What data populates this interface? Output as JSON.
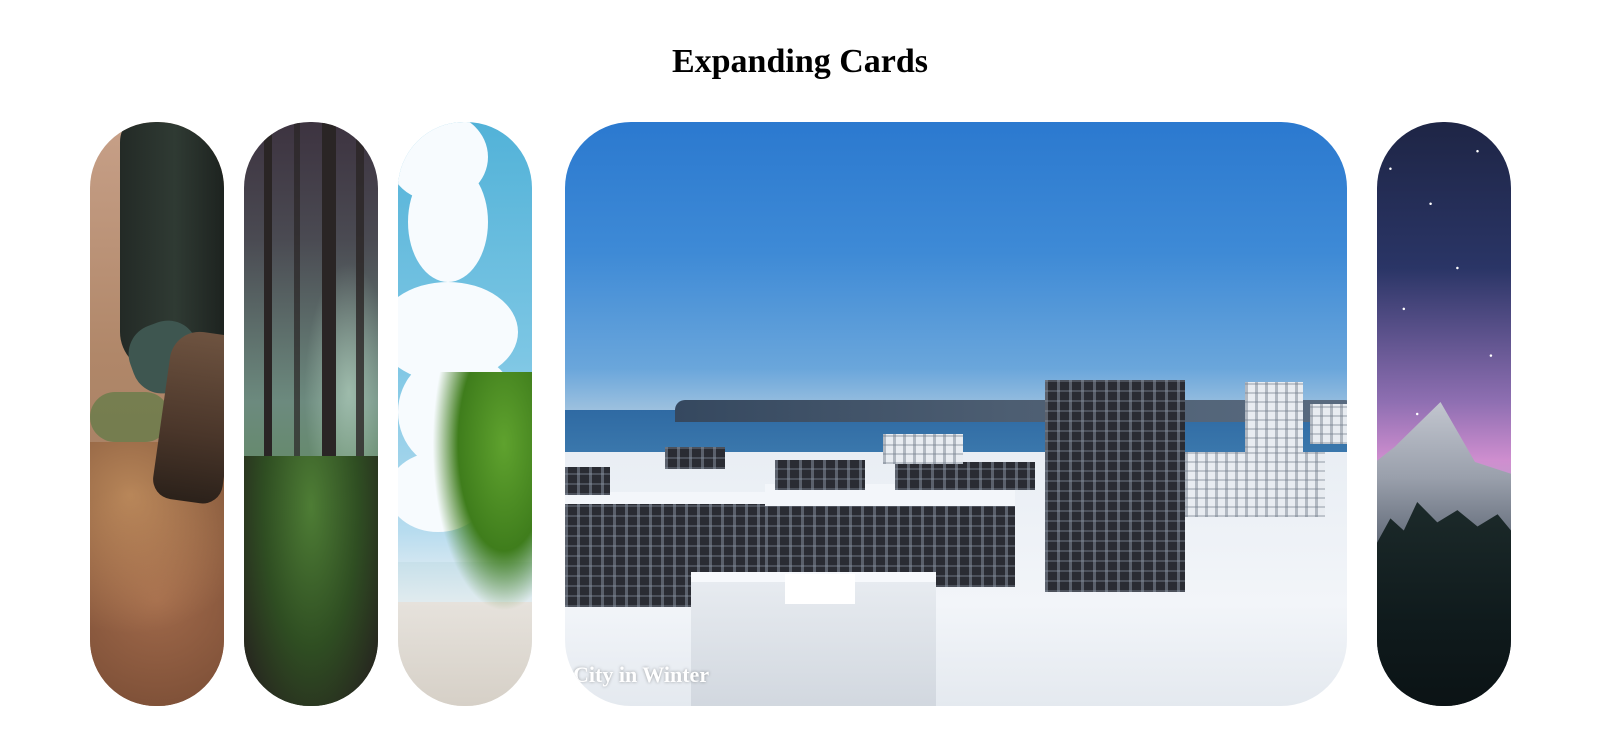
{
  "page": {
    "title": "Expanding Cards"
  },
  "cards": [
    {
      "id": "card-1",
      "scene": "hiking-boots-on-trail",
      "label": "",
      "active": false
    },
    {
      "id": "card-2",
      "scene": "misty-forest",
      "label": "",
      "active": false
    },
    {
      "id": "card-3",
      "scene": "tropical-beach-palm",
      "label": "",
      "active": false
    },
    {
      "id": "card-4",
      "scene": "snowy-city-by-the-sea",
      "label": "City in Winter",
      "active": true
    },
    {
      "id": "card-5",
      "scene": "starry-sky-over-mountain",
      "label": "",
      "active": false
    }
  ],
  "colors": {
    "background": "#ffffff",
    "title_text": "#000000",
    "label_text": "#ffffff"
  }
}
